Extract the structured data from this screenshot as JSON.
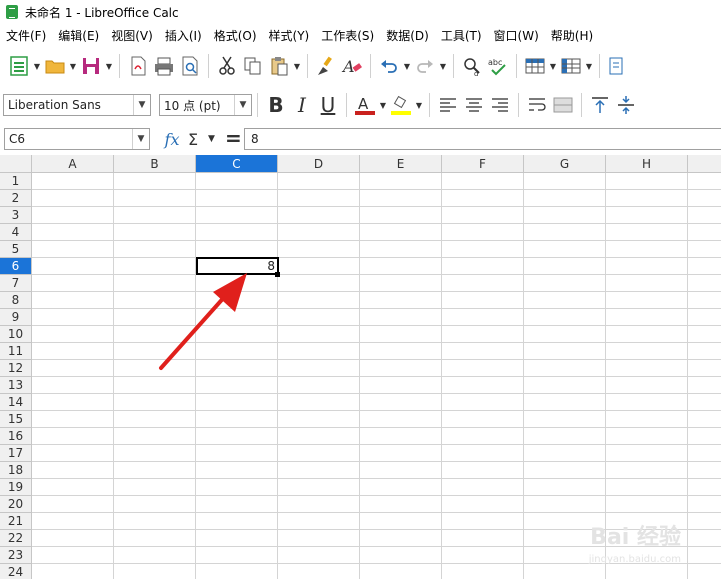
{
  "window": {
    "title": "未命名 1 - LibreOffice Calc"
  },
  "menu": [
    "文件(F)",
    "编辑(E)",
    "视图(V)",
    "插入(I)",
    "格式(O)",
    "样式(Y)",
    "工作表(S)",
    "数据(D)",
    "工具(T)",
    "窗口(W)",
    "帮助(H)"
  ],
  "font_box": {
    "name": "Liberation Sans",
    "size": "10 点 (pt)"
  },
  "formula_bar": {
    "cell_ref": "C6",
    "content": "8",
    "fx": "fx",
    "sigma": "Σ",
    "equals": "="
  },
  "columns": [
    "A",
    "B",
    "C",
    "D",
    "E",
    "F",
    "G",
    "H"
  ],
  "rows": [
    "1",
    "2",
    "3",
    "4",
    "5",
    "6",
    "7",
    "8",
    "9",
    "10",
    "11",
    "12",
    "13",
    "14",
    "15",
    "16",
    "17",
    "18",
    "19",
    "20",
    "21",
    "22",
    "23",
    "24"
  ],
  "selected": {
    "column": "C",
    "row": "6",
    "value": "8"
  },
  "accent_color": "#1b74d8",
  "annotation_color": "#e0201c",
  "watermark": {
    "main": "Bai 经验",
    "sub": "jingyan.baidu.com"
  }
}
